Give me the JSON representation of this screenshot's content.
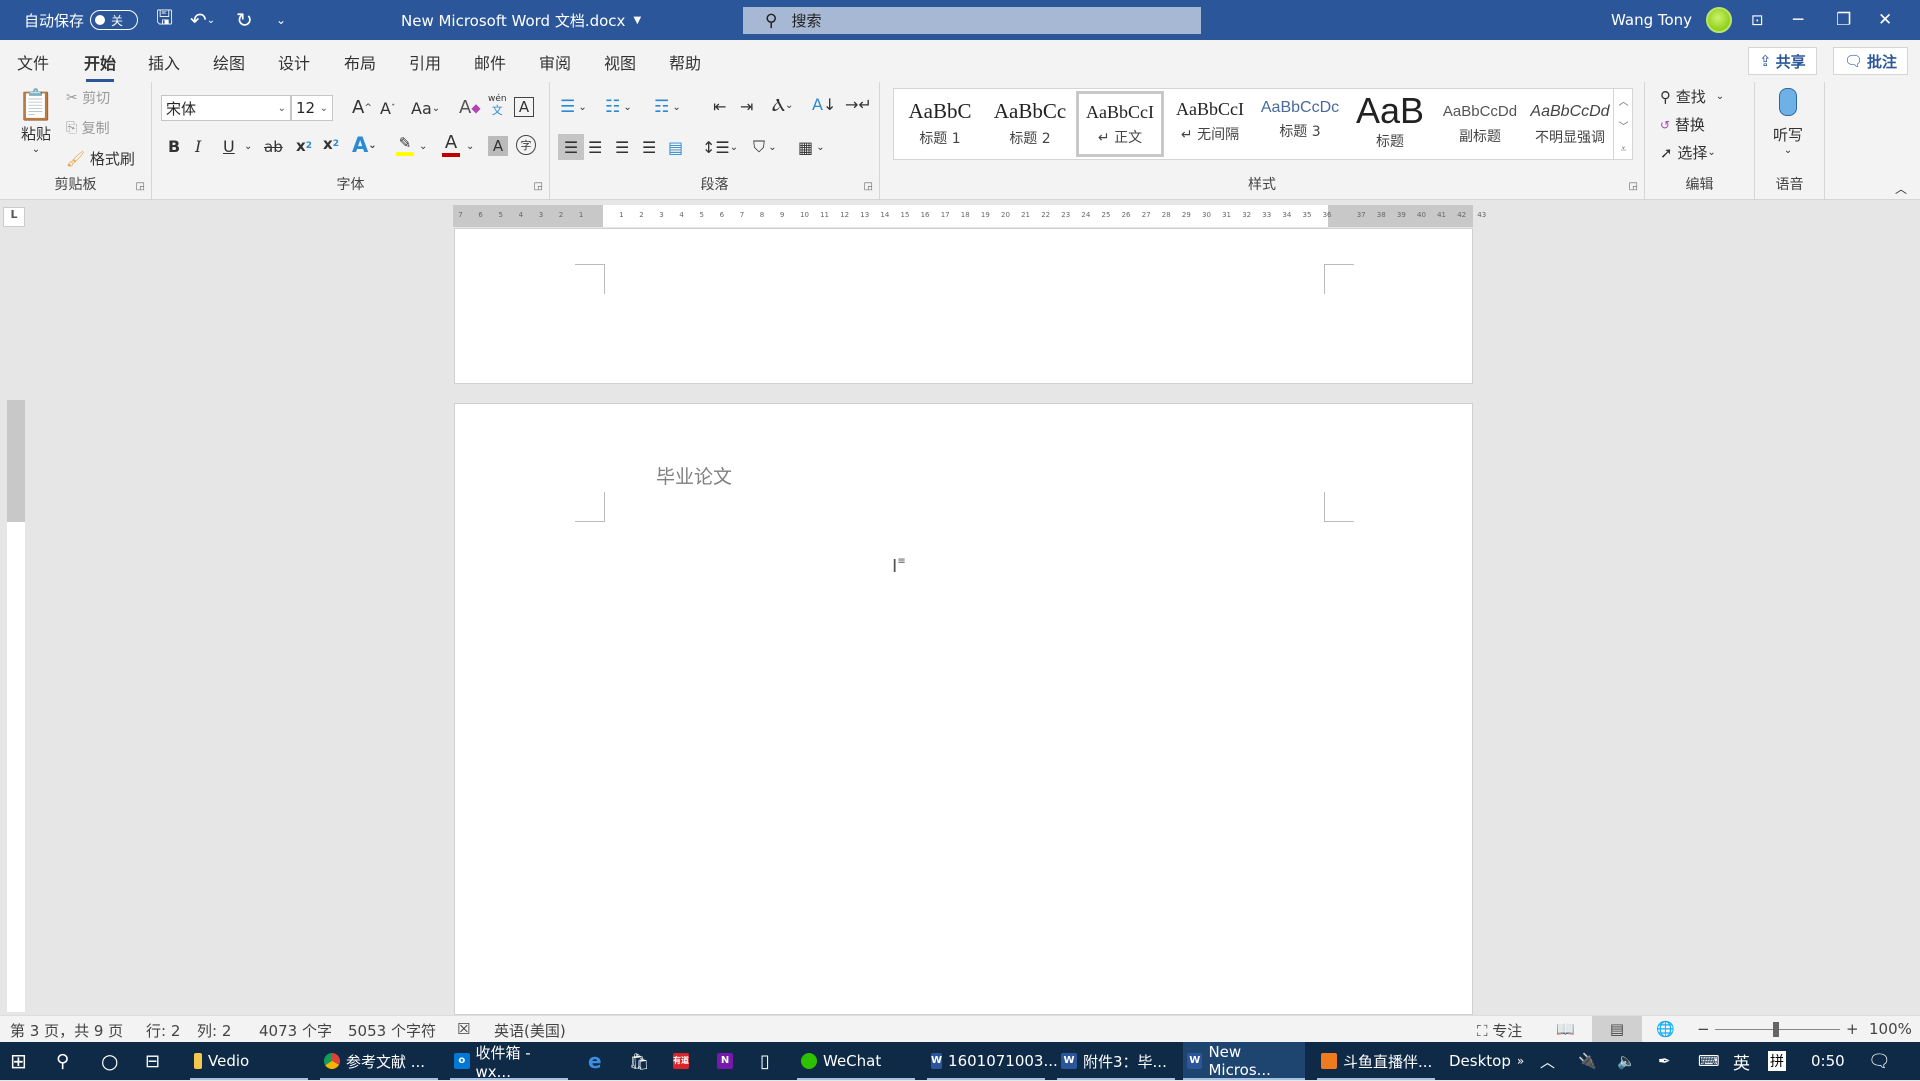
{
  "titlebar": {
    "autosave_label": "自动保存",
    "autosave_state": "关",
    "doc_title": "New Microsoft Word 文档.docx",
    "search_placeholder": "搜索",
    "user_name": "Wang Tony",
    "bg_color": "#2b579a"
  },
  "tabs": [
    "文件",
    "开始",
    "插入",
    "绘图",
    "设计",
    "布局",
    "引用",
    "邮件",
    "审阅",
    "视图",
    "帮助"
  ],
  "active_tab": "开始",
  "share": {
    "share_label": "共享",
    "comment_label": "批注"
  },
  "clipboard": {
    "paste": "粘贴",
    "cut": "剪切",
    "copy": "复制",
    "format_painter": "格式刷",
    "group_label": "剪贴板"
  },
  "font": {
    "font_name": "宋体",
    "font_size": "12",
    "change_case": "Aa",
    "phonetic_top": "wén",
    "phonetic_bottom": "文",
    "bold": "B",
    "italic": "I",
    "underline": "U",
    "strike": "ab",
    "group_label": "字体",
    "highlight_color": "#ffff00",
    "font_color": "#c00000"
  },
  "paragraph": {
    "group_label": "段落"
  },
  "styles": {
    "items": [
      {
        "preview": "AaBbC",
        "name": "标题 1"
      },
      {
        "preview": "AaBbCc",
        "name": "标题 2"
      },
      {
        "preview": "AaBbCcI",
        "name": "↵ 正文"
      },
      {
        "preview": "AaBbCcI",
        "name": "↵ 无间隔"
      },
      {
        "preview": "AaBbCcDc",
        "name": "标题 3"
      },
      {
        "preview": "AaB",
        "name": "标题"
      },
      {
        "preview": "AaBbCcDd",
        "name": "副标题"
      },
      {
        "preview": "AaBbCcDd",
        "name": "不明显强调"
      }
    ],
    "selected": "正文",
    "group_label": "样式"
  },
  "editing": {
    "find": "查找",
    "replace": "替换",
    "select": "选择",
    "group_label": "编辑"
  },
  "voice": {
    "dictate": "听写",
    "group_label": "语音"
  },
  "ruler": {
    "left_numbers": [
      "7",
      "6",
      "5",
      "4",
      "3",
      "2",
      "1"
    ],
    "right_numbers": [
      "1",
      "2",
      "3",
      "4",
      "5",
      "6",
      "7",
      "8",
      "9",
      "10",
      "11",
      "12",
      "13",
      "14",
      "15",
      "16",
      "17",
      "18",
      "19",
      "20",
      "21",
      "22",
      "23",
      "24",
      "25",
      "26",
      "27",
      "28",
      "29",
      "30",
      "31",
      "32",
      "33",
      "34",
      "35",
      "36"
    ],
    "overflow_numbers": [
      "37",
      "38",
      "39",
      "40",
      "41",
      "42",
      "43"
    ],
    "corner": "L"
  },
  "document": {
    "heading_text": "毕业论文"
  },
  "status": {
    "page": "第 3 页，共 9 页",
    "line": "行: 2",
    "column": "列: 2",
    "words": "4073 个字",
    "chars": "5053 个字符",
    "language": "英语(美国)",
    "focus": "专注",
    "zoom": "100%",
    "zoom_percent": 100
  },
  "taskbar": {
    "apps": [
      {
        "label": "Vedio",
        "icon": "folder-icon"
      },
      {
        "label": "参考文献 ...",
        "icon": "chrome-icon"
      },
      {
        "label": "收件箱 - wx...",
        "icon": "outlook-icon"
      },
      {
        "label": "WeChat",
        "icon": "wechat-icon"
      },
      {
        "label": "1601071003...",
        "icon": "word-icon"
      },
      {
        "label": "附件3：毕...",
        "icon": "word-icon"
      },
      {
        "label": "New Micros...",
        "icon": "word-icon"
      },
      {
        "label": "斗鱼直播伴...",
        "icon": "douyu-icon"
      }
    ],
    "desktop_label": "Desktop",
    "ime_lang": "英",
    "ime_mode": "拼",
    "time": "0:50"
  }
}
